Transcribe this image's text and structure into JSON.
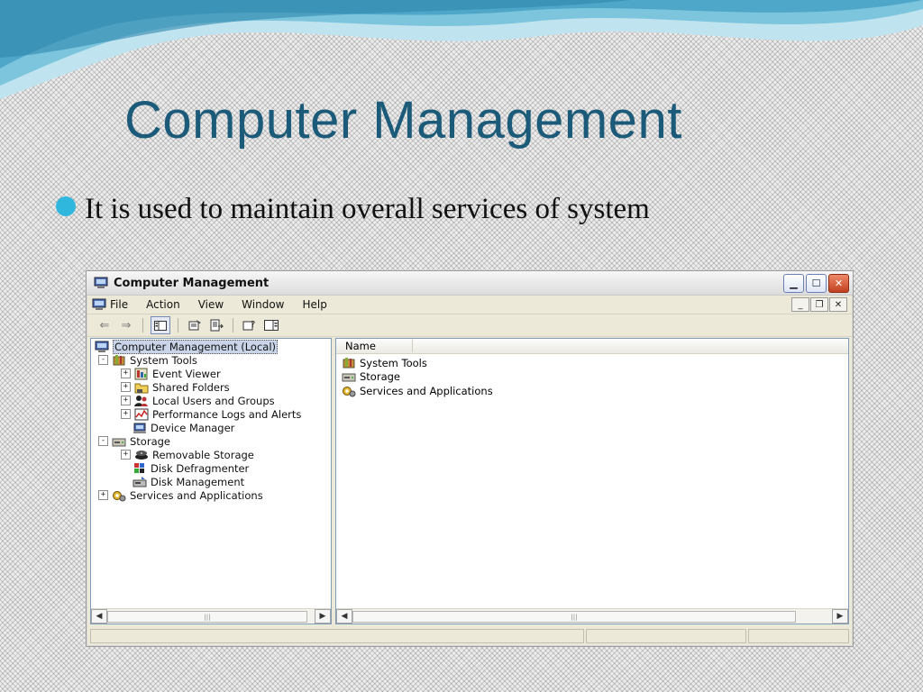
{
  "slide": {
    "title": "Computer Management",
    "bullet": "It is used to maintain overall services of system"
  },
  "colors": {
    "title": "#1b5a78",
    "bullet": "#2fb7dd",
    "wave": "#4ea7c8"
  },
  "window": {
    "title": "Computer Management",
    "menu": [
      "File",
      "Action",
      "View",
      "Window",
      "Help"
    ],
    "tree": [
      {
        "label": "Computer Management (Local)",
        "icon": "computer-icon",
        "expander": "",
        "selected": true
      },
      {
        "label": "System Tools",
        "icon": "tools-icon",
        "expander": "-"
      },
      {
        "label": "Event Viewer",
        "icon": "event-viewer-icon",
        "expander": "+"
      },
      {
        "label": "Shared Folders",
        "icon": "folder-icon",
        "expander": "+"
      },
      {
        "label": "Local Users and Groups",
        "icon": "users-icon",
        "expander": "+"
      },
      {
        "label": "Performance Logs and Alerts",
        "icon": "performance-icon",
        "expander": "+"
      },
      {
        "label": "Device Manager",
        "icon": "device-manager-icon",
        "expander": ""
      },
      {
        "label": "Storage",
        "icon": "storage-icon",
        "expander": "-"
      },
      {
        "label": "Removable Storage",
        "icon": "removable-storage-icon",
        "expander": "+"
      },
      {
        "label": "Disk Defragmenter",
        "icon": "defrag-icon",
        "expander": ""
      },
      {
        "label": "Disk Management",
        "icon": "disk-icon",
        "expander": ""
      },
      {
        "label": "Services and Applications",
        "icon": "services-icon",
        "expander": "+"
      }
    ],
    "list_header": "Name",
    "list": [
      {
        "label": "System Tools",
        "icon": "tools-icon"
      },
      {
        "label": "Storage",
        "icon": "storage-icon"
      },
      {
        "label": "Services and Applications",
        "icon": "services-icon"
      }
    ]
  }
}
